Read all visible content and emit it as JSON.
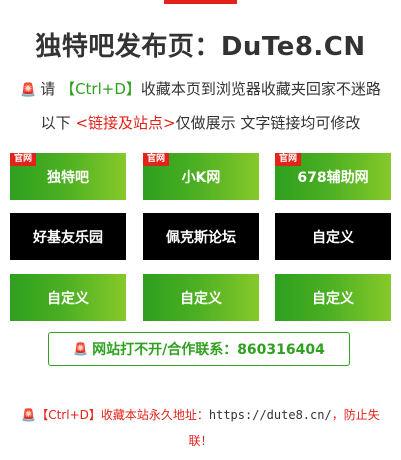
{
  "header": {
    "title": "独特吧发布页：DuTe8.CN"
  },
  "notice": {
    "bell_icon": "🚨",
    "line1_prefix": "请",
    "shortcut": "【Ctrl+D】",
    "line1_suffix": "收藏本页到浏览器收藏夹回家不迷路",
    "line2_prefix": "以下",
    "link_label": "<链接及站点>",
    "line2_suffix": "仅做展示 文字链接均可修改"
  },
  "tiles": [
    {
      "label": "独特吧",
      "badge": "官网",
      "style": "green"
    },
    {
      "label": "小K网",
      "badge": "官网",
      "style": "green"
    },
    {
      "label": "678辅助网",
      "badge": "官网",
      "style": "green"
    },
    {
      "label": "好基友乐园",
      "badge": "",
      "style": "black"
    },
    {
      "label": "佩克斯论坛",
      "badge": "",
      "style": "black"
    },
    {
      "label": "自定义",
      "badge": "",
      "style": "black"
    },
    {
      "label": "自定义",
      "badge": "",
      "style": "green"
    },
    {
      "label": "自定义",
      "badge": "",
      "style": "green"
    },
    {
      "label": "自定义",
      "badge": "",
      "style": "green"
    }
  ],
  "contact": {
    "icon": "🚨",
    "text": "网站打不开/合作联系：860316404"
  },
  "footer": {
    "icon": "🚨",
    "prefix": "【Ctrl+D】收藏本站永久地址：",
    "url": "https://dute8.cn/",
    "suffix_line1": "，防止失",
    "suffix_line2": "联！"
  },
  "colors": {
    "accent_red": "#e2231a",
    "accent_green": "#2fa11f"
  }
}
